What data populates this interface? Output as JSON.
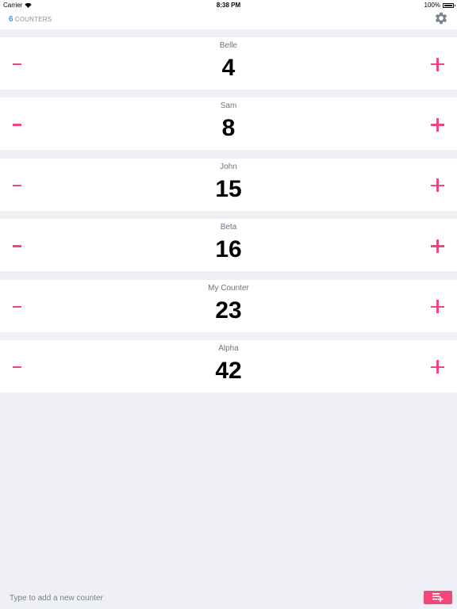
{
  "status_bar": {
    "carrier": "Carrier",
    "time": "8:38 PM",
    "battery": "100%"
  },
  "header": {
    "count": "6",
    "label": "COUNTERS",
    "settings_icon": "gear-icon"
  },
  "counters": [
    {
      "name": "Belle",
      "value": "4"
    },
    {
      "name": "Sam",
      "value": "8"
    },
    {
      "name": "John",
      "value": "15"
    },
    {
      "name": "Beta",
      "value": "16"
    },
    {
      "name": "My Counter",
      "value": "23"
    },
    {
      "name": "Alpha",
      "value": "42"
    }
  ],
  "footer": {
    "placeholder": "Type to add a new counter",
    "add_icon": "playlist-add-icon"
  },
  "colors": {
    "accent": "#f0487a",
    "count_blue": "#4a90e2",
    "background": "#eef0f5"
  }
}
